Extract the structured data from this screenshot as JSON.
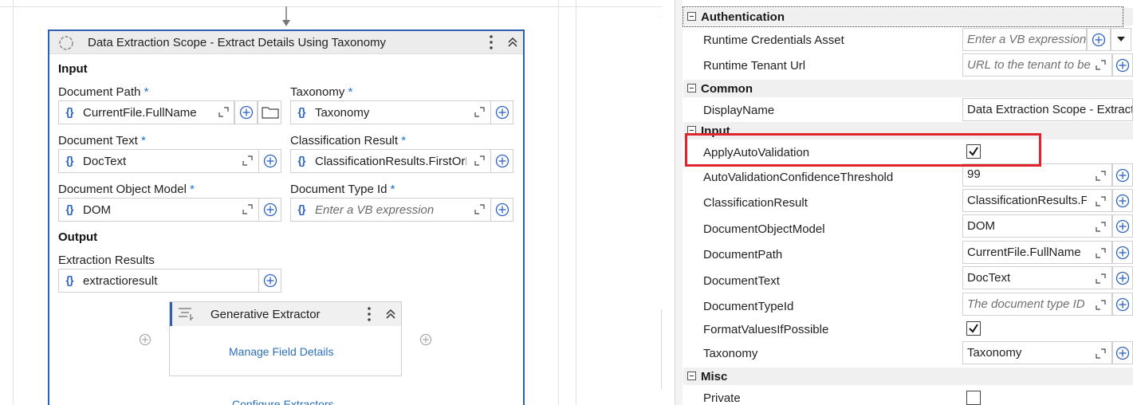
{
  "designer": {
    "scope_title": "Data Extraction Scope - Extract Details Using Taxonomy",
    "input_section": "Input",
    "output_section": "Output",
    "fields": {
      "document_path": {
        "label": "Document Path",
        "required": "*",
        "value": "CurrentFile.FullName"
      },
      "taxonomy": {
        "label": "Taxonomy",
        "required": "*",
        "value": "Taxonomy"
      },
      "document_text": {
        "label": "Document Text",
        "required": "*",
        "value": "DocText"
      },
      "classification_result": {
        "label": "Classification Result",
        "required": "*",
        "value": "ClassificationResults.FirstOrD"
      },
      "document_object_model": {
        "label": "Document Object Model",
        "required": "*",
        "value": "DOM"
      },
      "document_type_id": {
        "label": "Document Type Id",
        "required": "*",
        "placeholder": "Enter a VB expression"
      },
      "extraction_results": {
        "label": "Extraction Results",
        "value": "extractioresult"
      }
    },
    "brace_glyph": "{}",
    "child_activity": {
      "title": "Generative Extractor",
      "link": "Manage Field Details"
    },
    "configure_link": "Configure Extractors"
  },
  "properties": {
    "categories": {
      "authentication": "Authentication",
      "common": "Common",
      "input": "Input",
      "misc": "Misc"
    },
    "rows": {
      "runtime_credentials_asset": {
        "name": "Runtime Credentials Asset",
        "placeholder": "Enter a VB expression"
      },
      "runtime_tenant_url": {
        "name": "Runtime Tenant Url",
        "placeholder": "URL to the tenant to be"
      },
      "display_name": {
        "name": "DisplayName",
        "value": "Data Extraction Scope - Extract"
      },
      "apply_auto_validation": {
        "name": "ApplyAutoValidation",
        "checked": true
      },
      "auto_validation_threshold": {
        "name": "AutoValidationConfidenceThreshold",
        "value": "99"
      },
      "classification_result": {
        "name": "ClassificationResult",
        "value": "ClassificationResults.Fi"
      },
      "document_object_model": {
        "name": "DocumentObjectModel",
        "value": "DOM"
      },
      "document_path": {
        "name": "DocumentPath",
        "value": "CurrentFile.FullName"
      },
      "document_text": {
        "name": "DocumentText",
        "value": "DocText"
      },
      "document_type_id": {
        "name": "DocumentTypeId",
        "placeholder": "The document type ID"
      },
      "format_values": {
        "name": "FormatValuesIfPossible",
        "checked": true
      },
      "taxonomy": {
        "name": "Taxonomy",
        "value": "Taxonomy"
      },
      "private": {
        "name": "Private",
        "checked": false
      }
    }
  },
  "colors": {
    "accent": "#2f5fb5",
    "highlight": "#e0242c",
    "link": "#2c6fba"
  }
}
